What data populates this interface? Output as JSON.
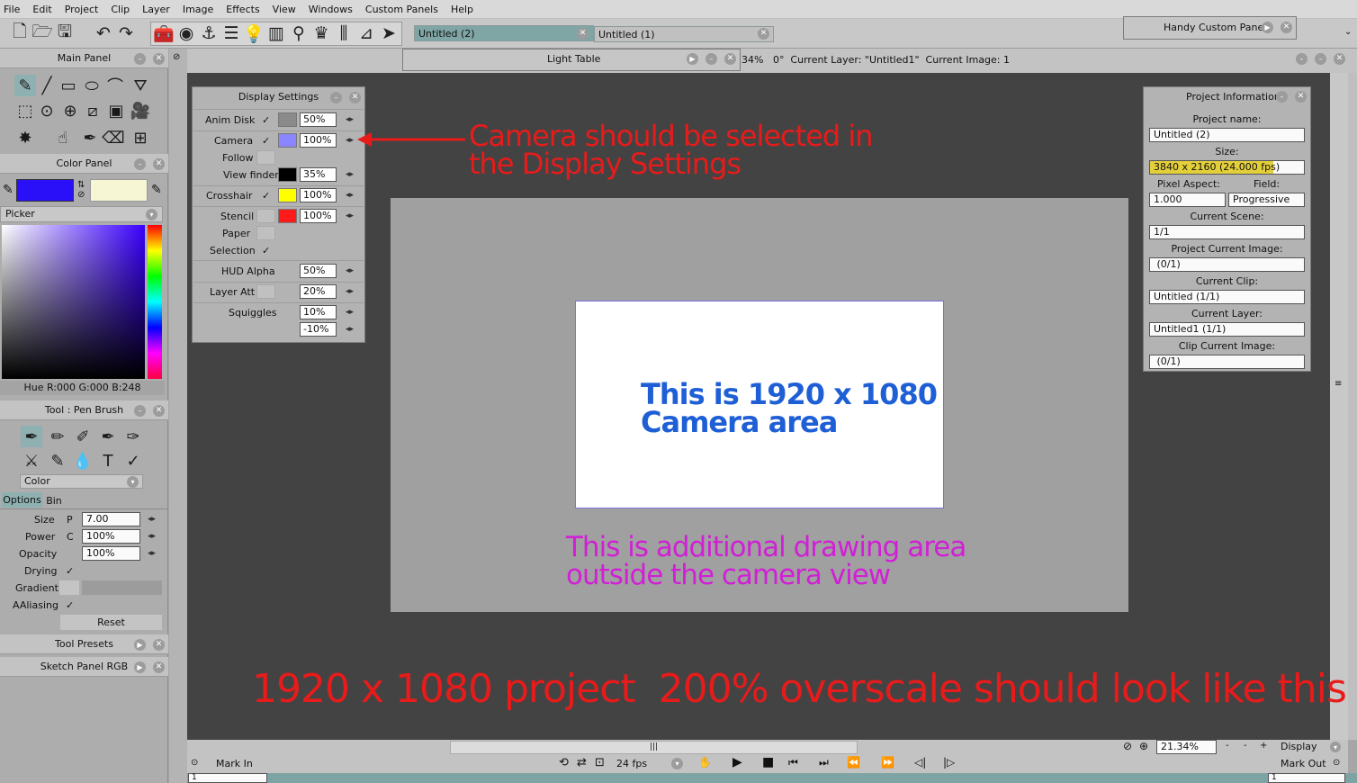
{
  "menubar": [
    "File",
    "Edit",
    "Project",
    "Clip",
    "Layer",
    "Image",
    "Effects",
    "View",
    "Windows",
    "Custom Panels",
    "Help"
  ],
  "tabs": {
    "active": "Untitled (2)",
    "inactive": "Untitled (1)"
  },
  "handy_pane": "Handy Custom Pane",
  "light_table": "Light Table",
  "viewport_status": "34%   0°  Current Layer: \"Untitled1\"  Current Image: 1",
  "left": {
    "main_panel": "Main Panel",
    "color_panel": "Color Panel",
    "picker_label": "Picker",
    "color_info": "Hue R:000 G:000 B:248",
    "primary_color": "#2a10f8",
    "secondary_color": "#f6f5d4",
    "tool_title": "Tool : Pen Brush",
    "tool_color_select": "Color",
    "tab_options": "Options",
    "tab_bin": "Bin",
    "size_label": "Size",
    "size_flag": "P",
    "size_value": "7.00",
    "power_label": "Power",
    "power_flag": "C",
    "power_value": "100%",
    "opacity_label": "Opacity",
    "opacity_value": "100%",
    "drying_label": "Drying",
    "gradient_label": "Gradient",
    "aaliasing_label": "AAliasing",
    "reset_label": "Reset",
    "tool_presets": "Tool Presets",
    "sketch_panel": "Sketch Panel RGB"
  },
  "display_settings": {
    "title": "Display Settings",
    "rows": [
      {
        "label": "Anim Disk",
        "check": true,
        "color": "#8a8a8a",
        "value": "50%"
      },
      {
        "label": "Camera",
        "check": true,
        "color": "#8b86ff",
        "value": "100%"
      },
      {
        "label": "Follow",
        "check": false,
        "color": "",
        "value": ""
      },
      {
        "label": "View finder",
        "check": false,
        "color": "#000000",
        "value": "35%"
      },
      {
        "label": "Crosshair",
        "check": true,
        "color": "#ffff00",
        "value": "100%"
      },
      {
        "label": "Stencil",
        "check": false,
        "color": "#ff1a1a",
        "value": "100%"
      },
      {
        "label": "Paper",
        "check": false,
        "color": "",
        "value": ""
      },
      {
        "label": "Selection",
        "check": true,
        "color": "",
        "value": ""
      },
      {
        "label": "HUD Alpha",
        "check": false,
        "color": "",
        "value": "50%"
      },
      {
        "label": "Layer Att",
        "check": false,
        "color": "",
        "value": "20%"
      },
      {
        "label": "Squiggles",
        "check": false,
        "color": "",
        "value": "10%"
      }
    ],
    "squiggles_second": "-10%"
  },
  "project_info": {
    "title": "Project Information",
    "project_name_label": "Project name:",
    "project_name": "Untitled (2)",
    "size_label": "Size:",
    "size_value": "3840 x 2160 (24.000 fps)",
    "pixel_aspect_label": "Pixel Aspect:",
    "field_label": "Field:",
    "pixel_aspect": "1.000",
    "field": "Progressive",
    "scene_label": "Current Scene:",
    "scene": "1/1",
    "proj_image_label": "Project Current Image:",
    "proj_image": " (0/1)",
    "clip_label": "Current Clip:",
    "clip": "Untitled (1/1)",
    "layer_label": "Current Layer:",
    "layer": "Untitled1 (1/1)",
    "clip_image_label": "Clip Current Image:",
    "clip_image": " (0/1)"
  },
  "annotations": {
    "camera_note_1": "Camera should be selected in",
    "camera_note_2": "the Display Settings",
    "camera_area_1": "This is 1920 x 1080",
    "camera_area_2": "Camera area",
    "extra_area_1": "This is additional drawing area",
    "extra_area_2": "outside the camera view",
    "bottom_note": "1920 x 1080 project  200% overscale should look like this"
  },
  "bottom": {
    "zoom": "21.34%",
    "display_label": "Display",
    "mark_in": "Mark In",
    "mark_out": "Mark Out",
    "fps": "24 fps",
    "frame_in": "1",
    "frame_out": "1"
  }
}
